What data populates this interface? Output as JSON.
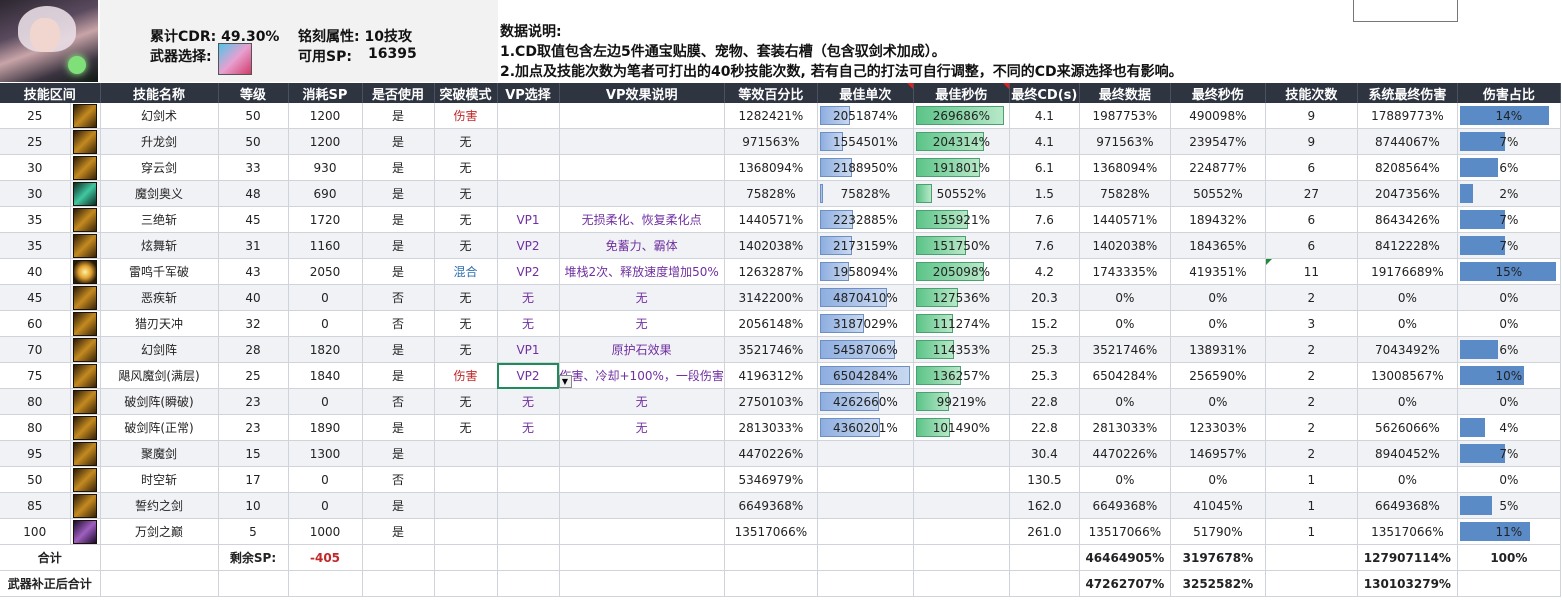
{
  "summary": {
    "cdr_label": "累计CDR: 49.30%",
    "inscription_label": "铭刻属性: 10技攻",
    "weapon_label": "武器选择:",
    "sp_label": "可用SP:",
    "sp_value": "16395"
  },
  "notes": {
    "title": "数据说明:",
    "line1": "1.CD取值包含左边5件通宝贴膜、宠物、套装右槽（包含驭剑术加成）。",
    "line2": "2.加点及技能次数为笔者可打出的40秒技能次数, 若有自己的打法可自行调整，不同的CD来源选择也有影响。"
  },
  "headers": [
    "技能区间",
    "技能名称",
    "等级",
    "消耗SP",
    "是否使用",
    "突破模式",
    "VP选择",
    "VP效果说明",
    "等效百分比",
    "最佳单次",
    "最佳秒伤",
    "最终CD(s)",
    "最终数据",
    "最终秒伤",
    "技能次数",
    "系统最终伤害",
    "伤害占比"
  ],
  "rows": [
    {
      "range": "25",
      "name": "幻剑术",
      "level": "50",
      "sp": "1200",
      "use": "是",
      "mode": "伤害",
      "vp": "",
      "vp_desc": "",
      "equiv": "1282421%",
      "best": "2051874%",
      "best_frac": 0.34,
      "dps": "269686%",
      "dps_frac": 0.98,
      "cd": "4.1",
      "final": "1987753%",
      "final_dps": "490098%",
      "count": "9",
      "sys": "17889773%",
      "ratio": "14%",
      "ratio_frac": 0.14,
      "icon": "gold"
    },
    {
      "range": "25",
      "name": "升龙剑",
      "level": "50",
      "sp": "1200",
      "use": "是",
      "mode": "无",
      "vp": "",
      "vp_desc": "",
      "equiv": "971563%",
      "best": "1554501%",
      "best_frac": 0.26,
      "dps": "204314%",
      "dps_frac": 0.76,
      "cd": "4.1",
      "final": "971563%",
      "final_dps": "239547%",
      "count": "9",
      "sys": "8744067%",
      "ratio": "7%",
      "ratio_frac": 0.07,
      "icon": "gold"
    },
    {
      "range": "30",
      "name": "穿云剑",
      "level": "33",
      "sp": "930",
      "use": "是",
      "mode": "无",
      "vp": "",
      "vp_desc": "",
      "equiv": "1368094%",
      "best": "2188950%",
      "best_frac": 0.36,
      "dps": "191801%",
      "dps_frac": 0.71,
      "cd": "6.1",
      "final": "1368094%",
      "final_dps": "224877%",
      "count": "6",
      "sys": "8208564%",
      "ratio": "6%",
      "ratio_frac": 0.06,
      "icon": "gold"
    },
    {
      "range": "30",
      "name": "魔剑奥义",
      "level": "48",
      "sp": "690",
      "use": "是",
      "mode": "无",
      "vp": "",
      "vp_desc": "",
      "equiv": "75828%",
      "best": "75828%",
      "best_frac": 0.0,
      "dps": "50552%",
      "dps_frac": 0.18,
      "cd": "1.5",
      "final": "75828%",
      "final_dps": "50552%",
      "count": "27",
      "sys": "2047356%",
      "ratio": "2%",
      "ratio_frac": 0.02,
      "icon": "teal"
    },
    {
      "range": "35",
      "name": "三绝斩",
      "level": "45",
      "sp": "1720",
      "use": "是",
      "mode": "无",
      "vp": "VP1",
      "vp_desc": "无损柔化、恢复柔化点",
      "equiv": "1440571%",
      "best": "2232885%",
      "best_frac": 0.37,
      "dps": "155921%",
      "dps_frac": 0.58,
      "cd": "7.6",
      "final": "1440571%",
      "final_dps": "189432%",
      "count": "6",
      "sys": "8643426%",
      "ratio": "7%",
      "ratio_frac": 0.07,
      "icon": "gold"
    },
    {
      "range": "35",
      "name": "炫舞斩",
      "level": "31",
      "sp": "1160",
      "use": "是",
      "mode": "无",
      "vp": "VP2",
      "vp_desc": "免蓄力、霸体",
      "equiv": "1402038%",
      "best": "2173159%",
      "best_frac": 0.36,
      "dps": "151750%",
      "dps_frac": 0.56,
      "cd": "7.6",
      "final": "1402038%",
      "final_dps": "184365%",
      "count": "6",
      "sys": "8412228%",
      "ratio": "7%",
      "ratio_frac": 0.07,
      "icon": "gold"
    },
    {
      "range": "40",
      "name": "雷鸣千军破",
      "level": "43",
      "sp": "2050",
      "use": "是",
      "mode": "混合",
      "vp": "VP2",
      "vp_desc": "堆栈2次、释放速度增加50%",
      "equiv": "1263287%",
      "best": "1958094%",
      "best_frac": 0.32,
      "dps": "205098%",
      "dps_frac": 0.76,
      "cd": "4.2",
      "final": "1743335%",
      "final_dps": "419351%",
      "count": "11",
      "sys": "19176689%",
      "ratio": "15%",
      "ratio_frac": 0.15,
      "icon": "glow"
    },
    {
      "range": "45",
      "name": "恶疾斩",
      "level": "40",
      "sp": "0",
      "use": "否",
      "mode": "无",
      "vp": "无",
      "vp_desc": "无",
      "equiv": "3142200%",
      "best": "4870410%",
      "best_frac": 0.75,
      "dps": "127536%",
      "dps_frac": 0.47,
      "cd": "20.3",
      "final": "0%",
      "final_dps": "0%",
      "count": "2",
      "sys": "0%",
      "ratio": "0%",
      "ratio_frac": 0,
      "icon": "gold"
    },
    {
      "range": "60",
      "name": "猎刃天冲",
      "level": "32",
      "sp": "0",
      "use": "否",
      "mode": "无",
      "vp": "无",
      "vp_desc": "无",
      "equiv": "2056148%",
      "best": "3187029%",
      "best_frac": 0.49,
      "dps": "111274%",
      "dps_frac": 0.41,
      "cd": "15.2",
      "final": "0%",
      "final_dps": "0%",
      "count": "3",
      "sys": "0%",
      "ratio": "0%",
      "ratio_frac": 0,
      "icon": "gold"
    },
    {
      "range": "70",
      "name": "幻剑阵",
      "level": "28",
      "sp": "1820",
      "use": "是",
      "mode": "无",
      "vp": "VP1",
      "vp_desc": "原护石效果",
      "equiv": "3521746%",
      "best": "5458706%",
      "best_frac": 0.84,
      "dps": "114353%",
      "dps_frac": 0.42,
      "cd": "25.3",
      "final": "3521746%",
      "final_dps": "138931%",
      "count": "2",
      "sys": "7043492%",
      "ratio": "6%",
      "ratio_frac": 0.06,
      "icon": "gold"
    },
    {
      "range": "75",
      "name": "飓风魔剑(满层)",
      "level": "25",
      "sp": "1840",
      "use": "是",
      "mode": "伤害",
      "vp": "VP2",
      "vp_desc": "伤害、冷却+100%，一段伤害",
      "equiv": "4196312%",
      "best": "6504284%",
      "best_frac": 1.0,
      "dps": "136257%",
      "dps_frac": 0.5,
      "cd": "25.3",
      "final": "6504284%",
      "final_dps": "256590%",
      "count": "2",
      "sys": "13008567%",
      "ratio": "10%",
      "ratio_frac": 0.1,
      "icon": "gold"
    },
    {
      "range": "80",
      "name": "破剑阵(瞬破)",
      "level": "23",
      "sp": "0",
      "use": "否",
      "mode": "无",
      "vp": "无",
      "vp_desc": "无",
      "equiv": "2750103%",
      "best": "4262660%",
      "best_frac": 0.66,
      "dps": "99219%",
      "dps_frac": 0.37,
      "cd": "22.8",
      "final": "0%",
      "final_dps": "0%",
      "count": "2",
      "sys": "0%",
      "ratio": "0%",
      "ratio_frac": 0,
      "icon": "gold"
    },
    {
      "range": "80",
      "name": "破剑阵(正常)",
      "level": "23",
      "sp": "1890",
      "use": "是",
      "mode": "无",
      "vp": "无",
      "vp_desc": "无",
      "equiv": "2813033%",
      "best": "4360201%",
      "best_frac": 0.67,
      "dps": "101490%",
      "dps_frac": 0.38,
      "cd": "22.8",
      "final": "2813033%",
      "final_dps": "123303%",
      "count": "2",
      "sys": "5626066%",
      "ratio": "4%",
      "ratio_frac": 0.04,
      "icon": "gold"
    },
    {
      "range": "95",
      "name": "聚魔剑",
      "level": "15",
      "sp": "1300",
      "use": "是",
      "mode": "",
      "vp": "",
      "vp_desc": "",
      "equiv": "4470226%",
      "best": "",
      "best_frac": 0,
      "dps": "",
      "dps_frac": 0,
      "cd": "30.4",
      "final": "4470226%",
      "final_dps": "146957%",
      "count": "2",
      "sys": "8940452%",
      "ratio": "7%",
      "ratio_frac": 0.07,
      "icon": "gold"
    },
    {
      "range": "50",
      "name": "时空斩",
      "level": "17",
      "sp": "0",
      "use": "否",
      "mode": "",
      "vp": "",
      "vp_desc": "",
      "equiv": "5346979%",
      "best": "",
      "best_frac": 0,
      "dps": "",
      "dps_frac": 0,
      "cd": "130.5",
      "final": "0%",
      "final_dps": "0%",
      "count": "1",
      "sys": "0%",
      "ratio": "0%",
      "ratio_frac": 0,
      "icon": "gold"
    },
    {
      "range": "85",
      "name": "誓约之剑",
      "level": "10",
      "sp": "0",
      "use": "是",
      "mode": "",
      "vp": "",
      "vp_desc": "",
      "equiv": "6649368%",
      "best": "",
      "best_frac": 0,
      "dps": "",
      "dps_frac": 0,
      "cd": "162.0",
      "final": "6649368%",
      "final_dps": "41045%",
      "count": "1",
      "sys": "6649368%",
      "ratio": "5%",
      "ratio_frac": 0.05,
      "icon": "gold"
    },
    {
      "range": "100",
      "name": "万剑之巅",
      "level": "5",
      "sp": "1000",
      "use": "是",
      "mode": "",
      "vp": "",
      "vp_desc": "",
      "equiv": "13517066%",
      "best": "",
      "best_frac": 0,
      "dps": "",
      "dps_frac": 0,
      "cd": "261.0",
      "final": "13517066%",
      "final_dps": "51790%",
      "count": "1",
      "sys": "13517066%",
      "ratio": "11%",
      "ratio_frac": 0.11,
      "icon": "purple"
    }
  ],
  "total": {
    "label": "合计",
    "remain_label": "剩余SP:",
    "remain_value": "-405",
    "final": "46464905%",
    "final_dps": "3197678%",
    "sys": "127907114%",
    "ratio": "100%"
  },
  "corrected": {
    "label": "武器补正后合计",
    "final": "47262707%",
    "final_dps": "3252582%",
    "sys": "130103279%"
  },
  "colors": {
    "header_bg": "#2e3440",
    "bar_blue": "#5b8bc7",
    "bar_green": "#5cc488",
    "mode_red": "#c0282a",
    "vp_purple": "#7030a0"
  }
}
